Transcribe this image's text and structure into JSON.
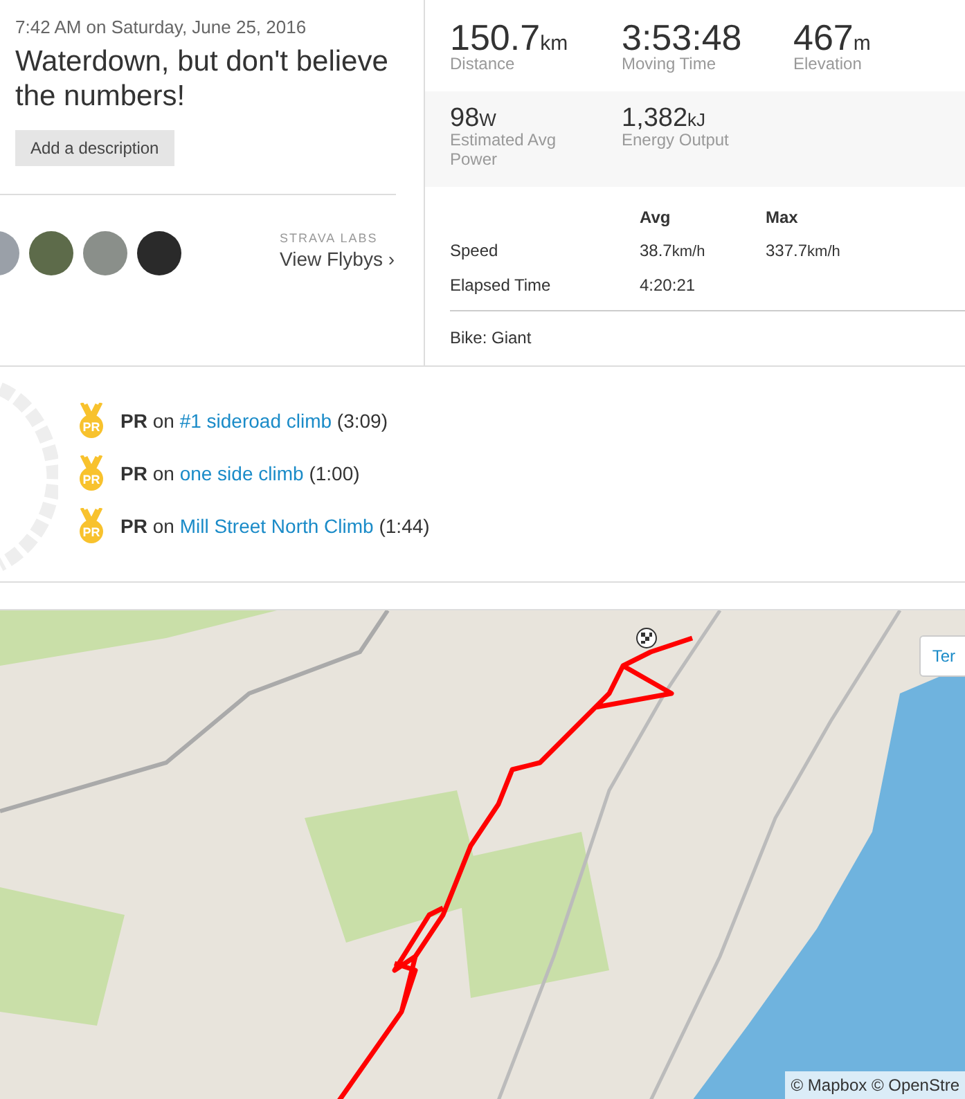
{
  "activity": {
    "datetime": "7:42 AM on Saturday, June 25, 2016",
    "title": "Waterdown, but don't believe the numbers!",
    "description_button": "Add a description"
  },
  "flybys": {
    "avatars": [
      {
        "kind": "photo"
      },
      {
        "kind": "photo"
      },
      {
        "kind": "photo"
      },
      {
        "kind": "photo"
      }
    ],
    "lab_label": "STRAVA LABS",
    "link": "View Flybys",
    "chevron": "›"
  },
  "primary_stats": [
    {
      "value": "150.7",
      "unit": "km",
      "label": "Distance"
    },
    {
      "value": "3:53:48",
      "label": "Moving Time"
    },
    {
      "value": "467",
      "unit": "m",
      "label": "Elevation"
    }
  ],
  "secondary_stats": [
    {
      "value": "98",
      "unit": "W",
      "label": "Estimated Avg Power"
    },
    {
      "value": "1,382",
      "unit": "kJ",
      "label": "Energy Output"
    }
  ],
  "stats_table": {
    "columns": [
      "",
      "Avg",
      "Max"
    ],
    "rows": [
      {
        "label": "Speed",
        "avg": "38.7",
        "avg_unit": "km/h",
        "max": "337.7",
        "max_unit": "km/h"
      },
      {
        "label": "Elapsed Time",
        "avg": "4:20:21"
      }
    ]
  },
  "gear": "Bike: Giant",
  "achievements": [
    {
      "badge": "PR",
      "type": "PR",
      "prefix": "on",
      "segment": "#1 sideroad climb",
      "time": "(3:09)"
    },
    {
      "badge": "PR",
      "type": "PR",
      "prefix": "on",
      "segment": "one side climb",
      "time": "(1:00)"
    },
    {
      "badge": "PR",
      "type": "PR",
      "prefix": "on",
      "segment": "Mill Street North Climb",
      "time": "(1:44)"
    }
  ],
  "map": {
    "attribution": "© Mapbox © OpenStre",
    "layer_button": "Ter"
  }
}
